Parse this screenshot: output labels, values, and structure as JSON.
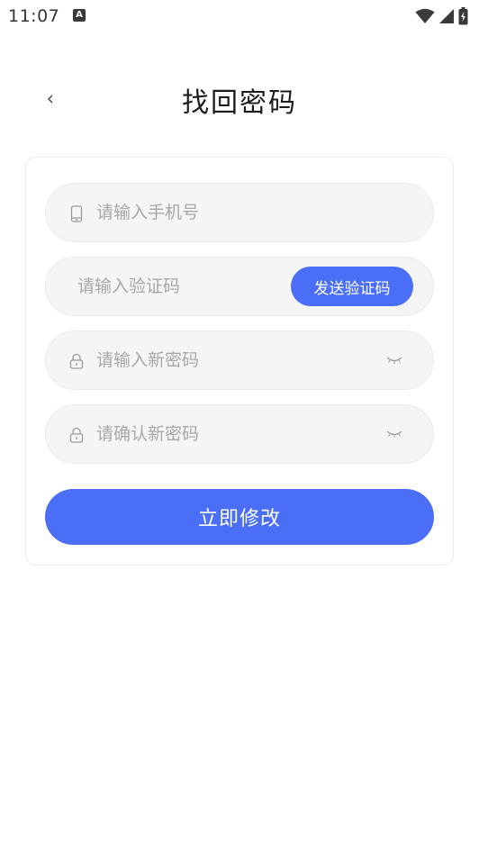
{
  "status_bar": {
    "time": "11:07",
    "notification_icon": "a-notification-icon",
    "icons": [
      "wifi-icon",
      "cell-signal-icon",
      "battery-icon"
    ]
  },
  "header": {
    "back_icon": "chevron-left-icon",
    "title": "找回密码"
  },
  "form": {
    "phone": {
      "icon": "phone-icon",
      "placeholder": "请输入手机号",
      "value": ""
    },
    "code": {
      "placeholder": "请输入验证码",
      "value": "",
      "send_button_label": "发送验证码"
    },
    "new_password": {
      "icon": "lock-icon",
      "placeholder": "请输入新密码",
      "value": "",
      "toggle_icon": "eye-closed-icon"
    },
    "confirm_password": {
      "icon": "lock-icon",
      "placeholder": "请确认新密码",
      "value": "",
      "toggle_icon": "eye-closed-icon"
    },
    "submit_label": "立即修改"
  },
  "colors": {
    "accent": "#4a6ef5",
    "field_bg": "#f5f5f5",
    "placeholder": "#a8a8a8"
  }
}
